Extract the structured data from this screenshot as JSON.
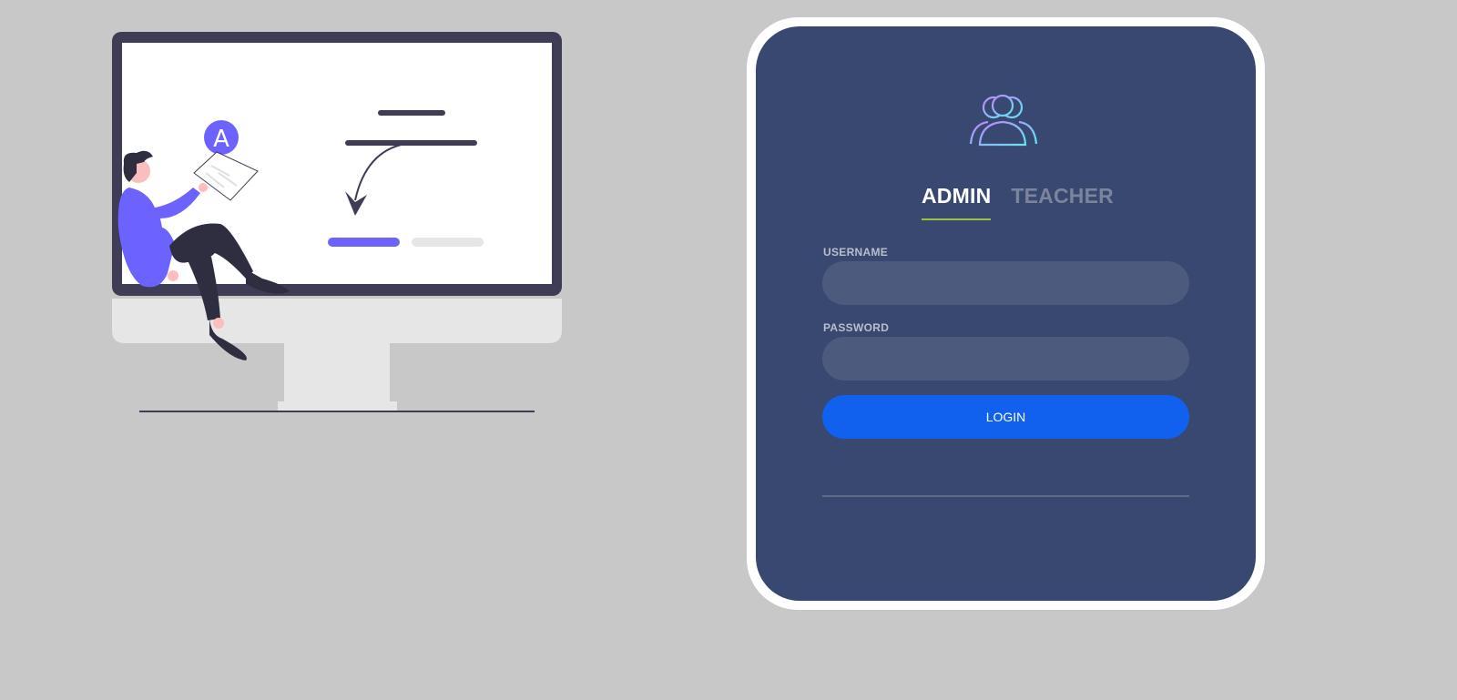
{
  "login": {
    "tabs": [
      {
        "label": "ADMIN",
        "active": true
      },
      {
        "label": "TEACHER",
        "active": false
      }
    ],
    "username_label": "USERNAME",
    "username_value": "",
    "password_label": "PASSWORD",
    "password_value": "",
    "login_button": "LOGIN"
  },
  "illustration": {
    "badge_letter": "A"
  },
  "colors": {
    "page_background": "#c8c8c8",
    "card": "#384870",
    "input": "#4c5a7d",
    "button": "#1161ee",
    "tab_underline": "#9cc23a",
    "accent_purple": "#6c63ff"
  },
  "icons": [
    "users-icon"
  ]
}
